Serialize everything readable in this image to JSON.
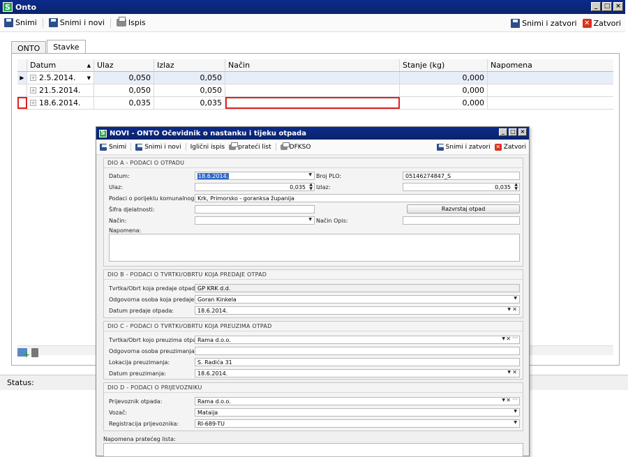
{
  "window": {
    "title": "Onto",
    "app_icon": "S"
  },
  "toolbar": {
    "save": "Snimi",
    "save_new": "Snimi i novi",
    "print": "Ispis",
    "save_close": "Snimi i zatvori",
    "close": "Zatvori"
  },
  "tabs": [
    "ONTO",
    "Stavke"
  ],
  "grid": {
    "headers": [
      "Datum",
      "Ulaz",
      "Izlaz",
      "Način",
      "Stanje (kg)",
      "Napomena"
    ],
    "rows": [
      {
        "datum": "2.5.2014.",
        "ulaz": "0,050",
        "izlaz": "0,050",
        "nacin": "",
        "stanje": "0,000",
        "napomena": ""
      },
      {
        "datum": "21.5.2014.",
        "ulaz": "0,050",
        "izlaz": "0,050",
        "nacin": "",
        "stanje": "0,000",
        "napomena": ""
      },
      {
        "datum": "18.6.2014.",
        "ulaz": "0,035",
        "izlaz": "0,035",
        "nacin": "",
        "stanje": "0,000",
        "napomena": ""
      }
    ]
  },
  "status": {
    "label": "Status:"
  },
  "dialog": {
    "title": "NOVI - ONTO Očevidnik o nastanku i tijeku otpada",
    "app_icon": "S",
    "toolbar": {
      "save": "Snimi",
      "save_new": "Snimi i novi",
      "print_form": "Iglični ispis",
      "accompanying_list": "prateći list",
      "dfkso": "DFKSO",
      "save_close": "Snimi i zatvori",
      "close": "Zatvori"
    },
    "sec_a": {
      "title": "DIO A - PODACI O OTPADU",
      "datum_label": "Datum:",
      "datum_value": "18.6.2014.",
      "broj_plo_label": "Broj PLO:",
      "broj_plo_value": "05146274847_S",
      "ulaz_label": "Ulaz:",
      "ulaz_value": "0,035",
      "izlaz_label": "Izlaz:",
      "izlaz_value": "0,035",
      "porijeklo_label": "Podaci o porijeklu komunalnog otpada:",
      "porijeklo_value": "Krk, Primorsko - goranksa županija",
      "sifra_label": "Šifra djelatnosti:",
      "sifra_value": "",
      "razvrstaj_button": "Razvrstaj otpad",
      "nacin_label": "Način:",
      "nacin_value": "",
      "nacin_opis_label": "Način Opis:",
      "nacin_opis_value": "",
      "napomena_label": "Napomena:"
    },
    "sec_b": {
      "title": "DIO B - PODACI O TVRTKI/OBRTU KOJA PREDAJE OTPAD",
      "tvrtka_label": "Tvrtka/Obrt koja predaje otpad:",
      "tvrtka_value": "GP KRK d.d.",
      "osoba_label": "Odgovorna osoba koja predaje otpad:",
      "osoba_value": "Goran Kinkela",
      "datum_label": "Datum predaje otpada:",
      "datum_value": "18.6.2014."
    },
    "sec_c": {
      "title": "DIO C - PODACI O TVRTKI/OBRTU KOJA PREUZIMA OTPAD",
      "tvrtka_label": "Tvrtka/Obrt kojo preuzima otpad:",
      "tvrtka_value": "Rama d.o.o.",
      "osoba_label": "Odgovorna osoba preuzimanja otpada:",
      "osoba_value": "",
      "lokacija_label": "Lokacija preuzimanja:",
      "lokacija_value": "S. Radića 31",
      "datum_label": "Datum preuzimanja:",
      "datum_value": "18.6.2014."
    },
    "sec_d": {
      "title": "DIO D - PODACI O PRIJEVOZNIKU",
      "prijevoznik_label": "Prijevoznik otpada:",
      "prijevoznik_value": "Rama d.o.o.",
      "vozac_label": "Vozač:",
      "vozac_value": "Mataija",
      "registracija_label": "Registracija prijevoznika:",
      "registracija_value": "RI-689-TU"
    },
    "napomena_pratecog_label": "Napomena pratećeg lista:"
  },
  "colors": {
    "title_bar": "#0a246a",
    "highlight": "#e02020",
    "selection": "#3168c4"
  }
}
